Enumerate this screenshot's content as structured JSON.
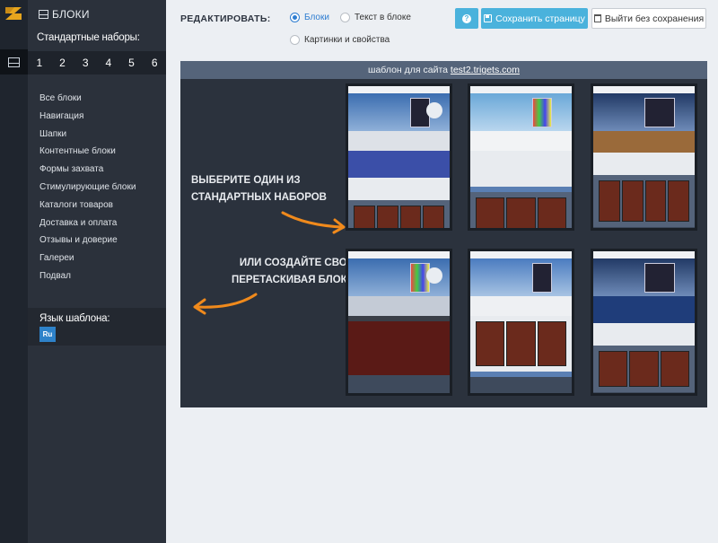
{
  "sidebar": {
    "title": "БЛОКИ",
    "sets_title": "Стандартные наборы:",
    "set_numbers": [
      "1",
      "2",
      "3",
      "4",
      "5",
      "6"
    ],
    "items": [
      {
        "label": "Все блоки"
      },
      {
        "label": "Навигация"
      },
      {
        "label": "Шапки"
      },
      {
        "label": "Контентные блоки"
      },
      {
        "label": "Формы захвата"
      },
      {
        "label": "Стимулирующие блоки"
      },
      {
        "label": "Каталоги товаров"
      },
      {
        "label": "Доставка и оплата"
      },
      {
        "label": "Отзывы и доверие"
      },
      {
        "label": "Галереи"
      },
      {
        "label": "Подвал"
      }
    ],
    "lang_title": "Язык шаблона:",
    "lang_button": "Ru"
  },
  "toolbar": {
    "edit_label": "РЕДАКТИРОВАТЬ:",
    "radio_blocks": "Блоки",
    "radio_text": "Текст в блоке",
    "radio_images": "Картинки и свойства",
    "selected": "Блоки",
    "save_label": "Сохранить страницу",
    "exit_label": "Выйти без сохранения"
  },
  "panel": {
    "header_prefix": "шаблон для сайта ",
    "site_link": "test2.trigets.com",
    "hint_top_line1": "ВЫБЕРИТЕ ОДИН ИЗ",
    "hint_top_line2": "СТАНДАРТНЫХ НАБОРОВ",
    "hint_bottom_line1": "ИЛИ СОЗДАЙТЕ СВОЙ",
    "hint_bottom_line2": "ПЕРЕТАСКИВАЯ БЛОКИ"
  },
  "icons": {
    "logo": "logo-icon",
    "blocks": "blocks-icon",
    "help": "question-icon",
    "save": "floppy-disk-icon",
    "exit": "trash-icon",
    "arrows": "arrow-icon"
  },
  "colors": {
    "accent": "#4ab2dc",
    "radio": "#2e7dd1",
    "arrow": "#f08a1c",
    "sidebar": "#2b313b",
    "panel": "#2b323d"
  }
}
